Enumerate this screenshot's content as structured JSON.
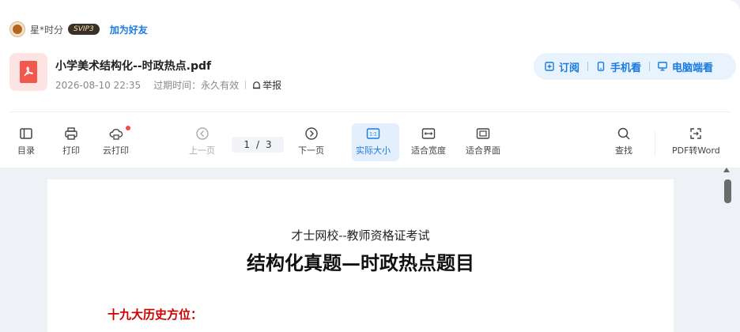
{
  "uploader": {
    "name": "星*时分",
    "badge": "SVIP3",
    "add_friend": "加为好友"
  },
  "file": {
    "title": "小学美术结构化--时政热点.pdf",
    "date": "2026-08-10 22:35",
    "expiry": "过期时间：永久有效",
    "report": "举报"
  },
  "actions": {
    "subscribe": "订阅",
    "mobile": "手机看",
    "desktop": "电脑端看"
  },
  "toolbar": {
    "catalog": "目录",
    "print": "打印",
    "cloud_print": "云打印",
    "prev": "上一页",
    "page_current": "1",
    "page_sep": "/",
    "page_total": "3",
    "next": "下一页",
    "actual_size": "实际大小",
    "fit_width": "适合宽度",
    "fit_page": "适合界面",
    "find": "查找",
    "to_word": "PDF转Word",
    "actual_size_icon_text": "1:1"
  },
  "document": {
    "school": "才士网校--教师资格证考试",
    "title": "结构化真题—时政热点题目",
    "section": "十九大历史方位："
  },
  "colors": {
    "accent": "#1a7ae0",
    "section_red": "#cc0000",
    "pdf_red": "#f2584e",
    "notify_dot": "#f24b4b"
  }
}
